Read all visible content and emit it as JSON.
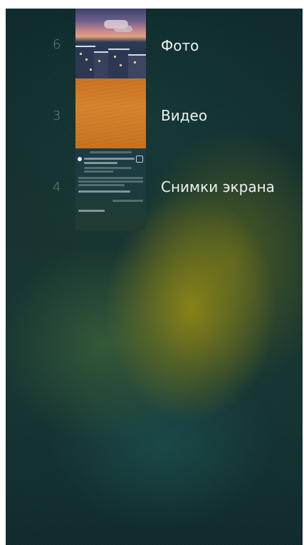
{
  "albums": [
    {
      "count": "6",
      "name": "Фото",
      "thumbnail_icon": "photo-thumbnail"
    },
    {
      "count": "3",
      "name": "Видео",
      "thumbnail_icon": "video-thumbnail"
    },
    {
      "count": "4",
      "name": "Снимки экрана",
      "thumbnail_icon": "screenshot-thumbnail"
    }
  ],
  "colors": {
    "background": "#163532",
    "glow": "#968c14",
    "text_primary": "#eef2f2",
    "text_count": "#8a9a9a"
  }
}
